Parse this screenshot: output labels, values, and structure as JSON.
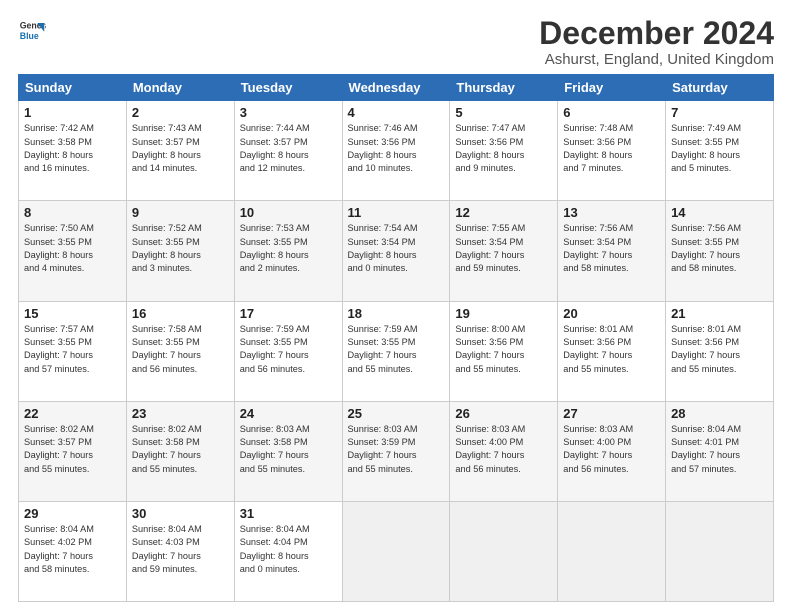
{
  "logo": {
    "line1": "General",
    "line2": "Blue"
  },
  "title": "December 2024",
  "subtitle": "Ashurst, England, United Kingdom",
  "days_of_week": [
    "Sunday",
    "Monday",
    "Tuesday",
    "Wednesday",
    "Thursday",
    "Friday",
    "Saturday"
  ],
  "weeks": [
    [
      {
        "day": "1",
        "info": "Sunrise: 7:42 AM\nSunset: 3:58 PM\nDaylight: 8 hours\nand 16 minutes."
      },
      {
        "day": "2",
        "info": "Sunrise: 7:43 AM\nSunset: 3:57 PM\nDaylight: 8 hours\nand 14 minutes."
      },
      {
        "day": "3",
        "info": "Sunrise: 7:44 AM\nSunset: 3:57 PM\nDaylight: 8 hours\nand 12 minutes."
      },
      {
        "day": "4",
        "info": "Sunrise: 7:46 AM\nSunset: 3:56 PM\nDaylight: 8 hours\nand 10 minutes."
      },
      {
        "day": "5",
        "info": "Sunrise: 7:47 AM\nSunset: 3:56 PM\nDaylight: 8 hours\nand 9 minutes."
      },
      {
        "day": "6",
        "info": "Sunrise: 7:48 AM\nSunset: 3:56 PM\nDaylight: 8 hours\nand 7 minutes."
      },
      {
        "day": "7",
        "info": "Sunrise: 7:49 AM\nSunset: 3:55 PM\nDaylight: 8 hours\nand 5 minutes."
      }
    ],
    [
      {
        "day": "8",
        "info": "Sunrise: 7:50 AM\nSunset: 3:55 PM\nDaylight: 8 hours\nand 4 minutes."
      },
      {
        "day": "9",
        "info": "Sunrise: 7:52 AM\nSunset: 3:55 PM\nDaylight: 8 hours\nand 3 minutes."
      },
      {
        "day": "10",
        "info": "Sunrise: 7:53 AM\nSunset: 3:55 PM\nDaylight: 8 hours\nand 2 minutes."
      },
      {
        "day": "11",
        "info": "Sunrise: 7:54 AM\nSunset: 3:54 PM\nDaylight: 8 hours\nand 0 minutes."
      },
      {
        "day": "12",
        "info": "Sunrise: 7:55 AM\nSunset: 3:54 PM\nDaylight: 7 hours\nand 59 minutes."
      },
      {
        "day": "13",
        "info": "Sunrise: 7:56 AM\nSunset: 3:54 PM\nDaylight: 7 hours\nand 58 minutes."
      },
      {
        "day": "14",
        "info": "Sunrise: 7:56 AM\nSunset: 3:55 PM\nDaylight: 7 hours\nand 58 minutes."
      }
    ],
    [
      {
        "day": "15",
        "info": "Sunrise: 7:57 AM\nSunset: 3:55 PM\nDaylight: 7 hours\nand 57 minutes."
      },
      {
        "day": "16",
        "info": "Sunrise: 7:58 AM\nSunset: 3:55 PM\nDaylight: 7 hours\nand 56 minutes."
      },
      {
        "day": "17",
        "info": "Sunrise: 7:59 AM\nSunset: 3:55 PM\nDaylight: 7 hours\nand 56 minutes."
      },
      {
        "day": "18",
        "info": "Sunrise: 7:59 AM\nSunset: 3:55 PM\nDaylight: 7 hours\nand 55 minutes."
      },
      {
        "day": "19",
        "info": "Sunrise: 8:00 AM\nSunset: 3:56 PM\nDaylight: 7 hours\nand 55 minutes."
      },
      {
        "day": "20",
        "info": "Sunrise: 8:01 AM\nSunset: 3:56 PM\nDaylight: 7 hours\nand 55 minutes."
      },
      {
        "day": "21",
        "info": "Sunrise: 8:01 AM\nSunset: 3:56 PM\nDaylight: 7 hours\nand 55 minutes."
      }
    ],
    [
      {
        "day": "22",
        "info": "Sunrise: 8:02 AM\nSunset: 3:57 PM\nDaylight: 7 hours\nand 55 minutes."
      },
      {
        "day": "23",
        "info": "Sunrise: 8:02 AM\nSunset: 3:58 PM\nDaylight: 7 hours\nand 55 minutes."
      },
      {
        "day": "24",
        "info": "Sunrise: 8:03 AM\nSunset: 3:58 PM\nDaylight: 7 hours\nand 55 minutes."
      },
      {
        "day": "25",
        "info": "Sunrise: 8:03 AM\nSunset: 3:59 PM\nDaylight: 7 hours\nand 55 minutes."
      },
      {
        "day": "26",
        "info": "Sunrise: 8:03 AM\nSunset: 4:00 PM\nDaylight: 7 hours\nand 56 minutes."
      },
      {
        "day": "27",
        "info": "Sunrise: 8:03 AM\nSunset: 4:00 PM\nDaylight: 7 hours\nand 56 minutes."
      },
      {
        "day": "28",
        "info": "Sunrise: 8:04 AM\nSunset: 4:01 PM\nDaylight: 7 hours\nand 57 minutes."
      }
    ],
    [
      {
        "day": "29",
        "info": "Sunrise: 8:04 AM\nSunset: 4:02 PM\nDaylight: 7 hours\nand 58 minutes."
      },
      {
        "day": "30",
        "info": "Sunrise: 8:04 AM\nSunset: 4:03 PM\nDaylight: 7 hours\nand 59 minutes."
      },
      {
        "day": "31",
        "info": "Sunrise: 8:04 AM\nSunset: 4:04 PM\nDaylight: 8 hours\nand 0 minutes."
      },
      {
        "day": "",
        "info": ""
      },
      {
        "day": "",
        "info": ""
      },
      {
        "day": "",
        "info": ""
      },
      {
        "day": "",
        "info": ""
      }
    ]
  ]
}
